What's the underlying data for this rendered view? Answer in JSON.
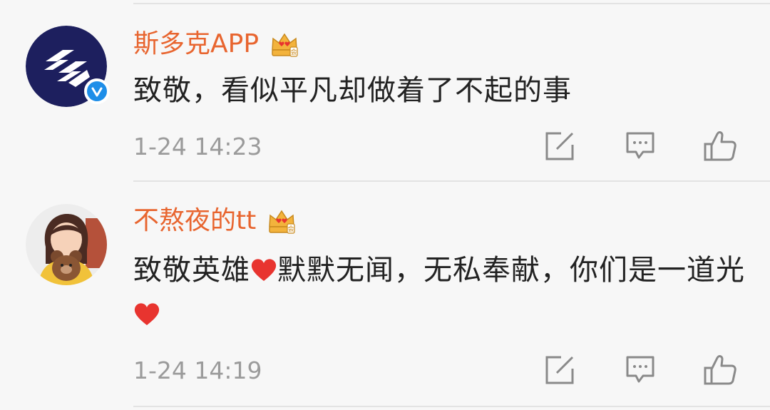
{
  "comments": [
    {
      "username": "斯多克APP",
      "text": "致敬，看似平凡却做着了不起的事",
      "timestamp": "1-24 14:23",
      "avatar": "stocke-logo",
      "verified": true,
      "badge_icon": "crown-icon"
    },
    {
      "username": "不熬夜的tt",
      "text_part1": "致敬英雄",
      "text_part2": "默默无闻，无私奉献，你们是一道光",
      "timestamp": "1-24 14:19",
      "avatar": "girl-with-teddy-bear",
      "verified": false,
      "badge_icon": "crown-icon",
      "emoji": "heart"
    }
  ],
  "actions": [
    "share-icon",
    "reply-icon",
    "like-icon"
  ],
  "colors": {
    "username": "#e8652f",
    "text": "#222222",
    "timestamp": "#9b9b9b",
    "background": "#f7f7f7",
    "verified": "#1e8ee8",
    "heart": "#e8342f",
    "crown": "#f3b33c"
  }
}
